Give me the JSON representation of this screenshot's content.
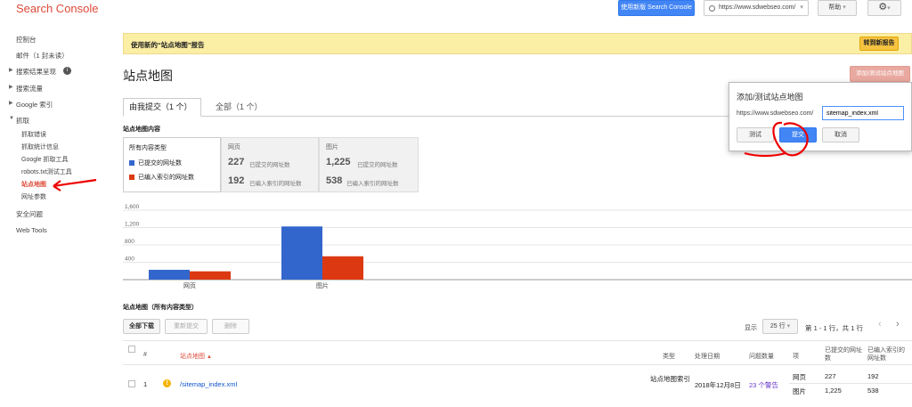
{
  "header": {
    "app_title": "Search Console",
    "new_version_label": "使用新版 Search Console",
    "property": "https://www.sdwebseo.com/",
    "help_label": "帮助"
  },
  "sidebar": {
    "items": [
      {
        "label": "控制台"
      },
      {
        "label": "邮件（1 封未读）"
      },
      {
        "label": "搜索结果呈现"
      },
      {
        "label": "搜索流量"
      },
      {
        "label": "Google 索引"
      },
      {
        "label": "抓取"
      },
      {
        "label": "抓取错误"
      },
      {
        "label": "抓取统计信息"
      },
      {
        "label": "Google 抓取工具"
      },
      {
        "label": "robots.txt测试工具"
      },
      {
        "label": "站点地图"
      },
      {
        "label": "网址参数"
      },
      {
        "label": "安全问题"
      },
      {
        "label": "Web Tools"
      }
    ]
  },
  "banner": {
    "text": "使用新的“站点地图”报告",
    "button": "转到新报告"
  },
  "page": {
    "title": "站点地图",
    "add_button": "添加/测试站点地图",
    "tabs": [
      "由我提交（1 个）",
      "全部（1 个）"
    ],
    "content_label": "站点地图内容"
  },
  "popup": {
    "title": "添加/测试站点地图",
    "prefix": "https://www.sdwebseo.com/",
    "input_value": "sitemap_index.xml",
    "test": "测试",
    "submit": "提交",
    "cancel": "取消"
  },
  "stats": {
    "all_types": "所有内容类型",
    "legend_submitted": "已提交的网址数",
    "legend_indexed": "已编入索引的网址数",
    "web_label": "网页",
    "img_label": "图片",
    "web_submitted": "227",
    "web_indexed": "192",
    "img_submitted": "1,225",
    "img_indexed": "538",
    "submitted_suffix": "已提交的网址数",
    "indexed_suffix": "已编入索引的网址数"
  },
  "chart_data": {
    "type": "bar",
    "categories": [
      "网页",
      "图片"
    ],
    "series": [
      {
        "name": "已提交的网址数",
        "values": [
          227,
          1225
        ],
        "color": "#3366cc"
      },
      {
        "name": "已编入索引的网址数",
        "values": [
          192,
          538
        ],
        "color": "#dc3912"
      }
    ],
    "y_ticks": [
      "1,600",
      "1,200",
      "800",
      "400"
    ],
    "ylim": [
      0,
      1600
    ]
  },
  "table": {
    "section_title": "站点地图（所有内容类型）",
    "download_all": "全部下载",
    "resubmit": "重新提交",
    "delete": "删除",
    "show_label": "显示",
    "rows_select": "25 行",
    "pagination": "第 1 - 1 行，共 1 行",
    "headers": {
      "num": "#",
      "sitemap": "站点地图",
      "type": "类型",
      "processed": "处理日期",
      "issues": "问题数量",
      "item": "项",
      "submitted": "已提交的网址数",
      "indexed": "已编入索引的网址数"
    },
    "row": {
      "num": "1",
      "sitemap": "/sitemap_index.xml",
      "type": "站点地图索引",
      "processed": "2018年12月8日",
      "issues": "23 个警告",
      "item1": "网页",
      "sub1": "227",
      "idx1": "192",
      "item2": "图片",
      "sub2": "1,225",
      "idx2": "538"
    }
  }
}
